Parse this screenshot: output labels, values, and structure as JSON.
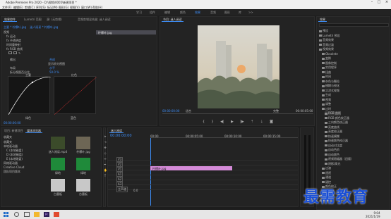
{
  "window": {
    "title": "Adobe Premiere Pro 2020 - D:\\视频\\0005\\新建项目 *"
  },
  "menu": [
    "文件(F)",
    "编辑(E)",
    "剪辑(C)",
    "序列(S)",
    "标记(M)",
    "图形(G)",
    "视图(V)",
    "窗口(W)",
    "帮助(H)"
  ],
  "workspaces": [
    "学习",
    "组件",
    "编辑",
    "颜色",
    "效果",
    "音频",
    "图形",
    "库",
    ">>"
  ],
  "active_workspace": "效果",
  "effect_controls": {
    "tabs": [
      "效果控件",
      "Lumetri 范围",
      "源: (无剪辑)",
      "音频剪辑混合器: 迷人阅读"
    ],
    "path": "主要 * 柠檬叶.jpg",
    "sequence": "迷人阅读 * 柠檬叶.jpg",
    "clip_name": "柠檬叶.jpg",
    "rows": [
      "视频",
      "fx 运动",
      "fx 不透明度",
      "时间重映射",
      "fx RGB 曲线",
      "输出",
      "显示拆分视图",
      "布局",
      "拆分视图百分比"
    ],
    "output_value": "合成",
    "layout_value": "水平",
    "split_value": "50.0 %",
    "curve_label_main": "主要",
    "curve_label_red": "红色",
    "curve_label_green": "绿色",
    "curve_label_blue": "蓝色",
    "timecode": "00:00:00:00"
  },
  "program": {
    "tab": "节目: 迷人阅读",
    "timecode_left": "00:00:00:00",
    "fit": "适合",
    "quality": "完整",
    "timecode_right": "00:00:05:00"
  },
  "effects": {
    "tab": "效果",
    "items": [
      "预设",
      "Lumetri 预设",
      "音频效果",
      "音频过渡",
      "视频效果",
      "Obsolete",
      "变换",
      "图像控制",
      "实用程序",
      "扭曲",
      "时间",
      "杂色与颗粒",
      "模糊与锐化",
      "沉浸式视频",
      "生成",
      "视频",
      "调整",
      "过时",
      "RGB 曲线",
      "RGB 颜色校正器",
      "三向颜色校正器",
      "亮度曲线",
      "亮度校正器",
      "快速模糊",
      "快速颜色校正器",
      "自动对比度",
      "自动色阶",
      "自动颜色",
      "视频限幅器（旧版）",
      "阴影/高光",
      "过渡",
      "透视",
      "通道",
      "键控",
      "颜色校正",
      "风格化",
      "视频过渡"
    ],
    "footer": "基本图形"
  },
  "project": {
    "tabs": [
      "项目: 新建项目",
      "媒体浏览器"
    ],
    "drive_label": "收藏夹",
    "tree": [
      "收藏夹",
      "本地驱动器",
      "C (本地磁盘)",
      "D (本地磁盘)",
      "E (本地磁盘)",
      "网络驱动器",
      "Creative Cloud",
      "团队项目版本"
    ],
    "thumbs": [
      "迷人阅读.mp4",
      "柠檬叶.jpg",
      "绿地",
      "绿地",
      "白墨板",
      "台墨板"
    ]
  },
  "timeline": {
    "tab": "迷人阅读",
    "timecode": "00:00:00:00",
    "tracks": [
      "V3",
      "V2",
      "V1",
      "A1",
      "A2",
      "A3",
      "主声道"
    ],
    "master_value": "0.0",
    "clip_label": "柠檬叶.jpg",
    "ruler": [
      "00:00",
      "00:00:05:00",
      "00:00:10:00",
      "00:00:15:00"
    ]
  },
  "taskbar": {
    "time": "9:04",
    "date": "2021/1/19"
  },
  "watermark": "最需教育"
}
